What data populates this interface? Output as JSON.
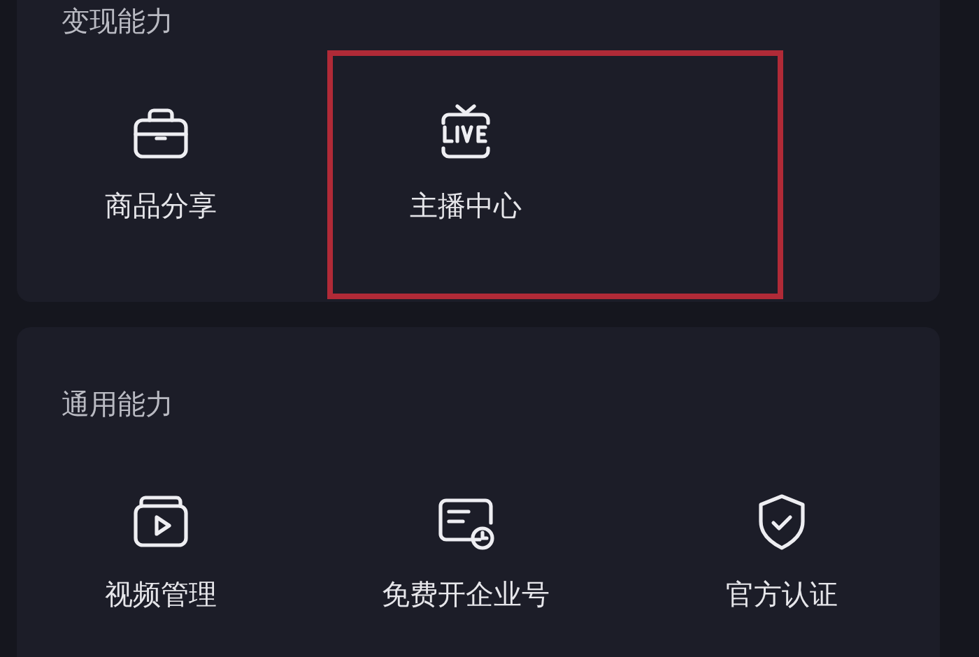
{
  "sections": [
    {
      "title": "变现能力",
      "items": [
        {
          "label": "商品分享",
          "kind": "briefcase",
          "highlighted": false
        },
        {
          "label": "主播中心",
          "kind": "live",
          "highlighted": true
        }
      ]
    },
    {
      "title": "通用能力",
      "items": [
        {
          "label": "视频管理",
          "kind": "video",
          "highlighted": false
        },
        {
          "label": "免费开企业号",
          "kind": "card",
          "highlighted": false
        },
        {
          "label": "官方认证",
          "kind": "shield",
          "highlighted": false
        }
      ]
    }
  ]
}
